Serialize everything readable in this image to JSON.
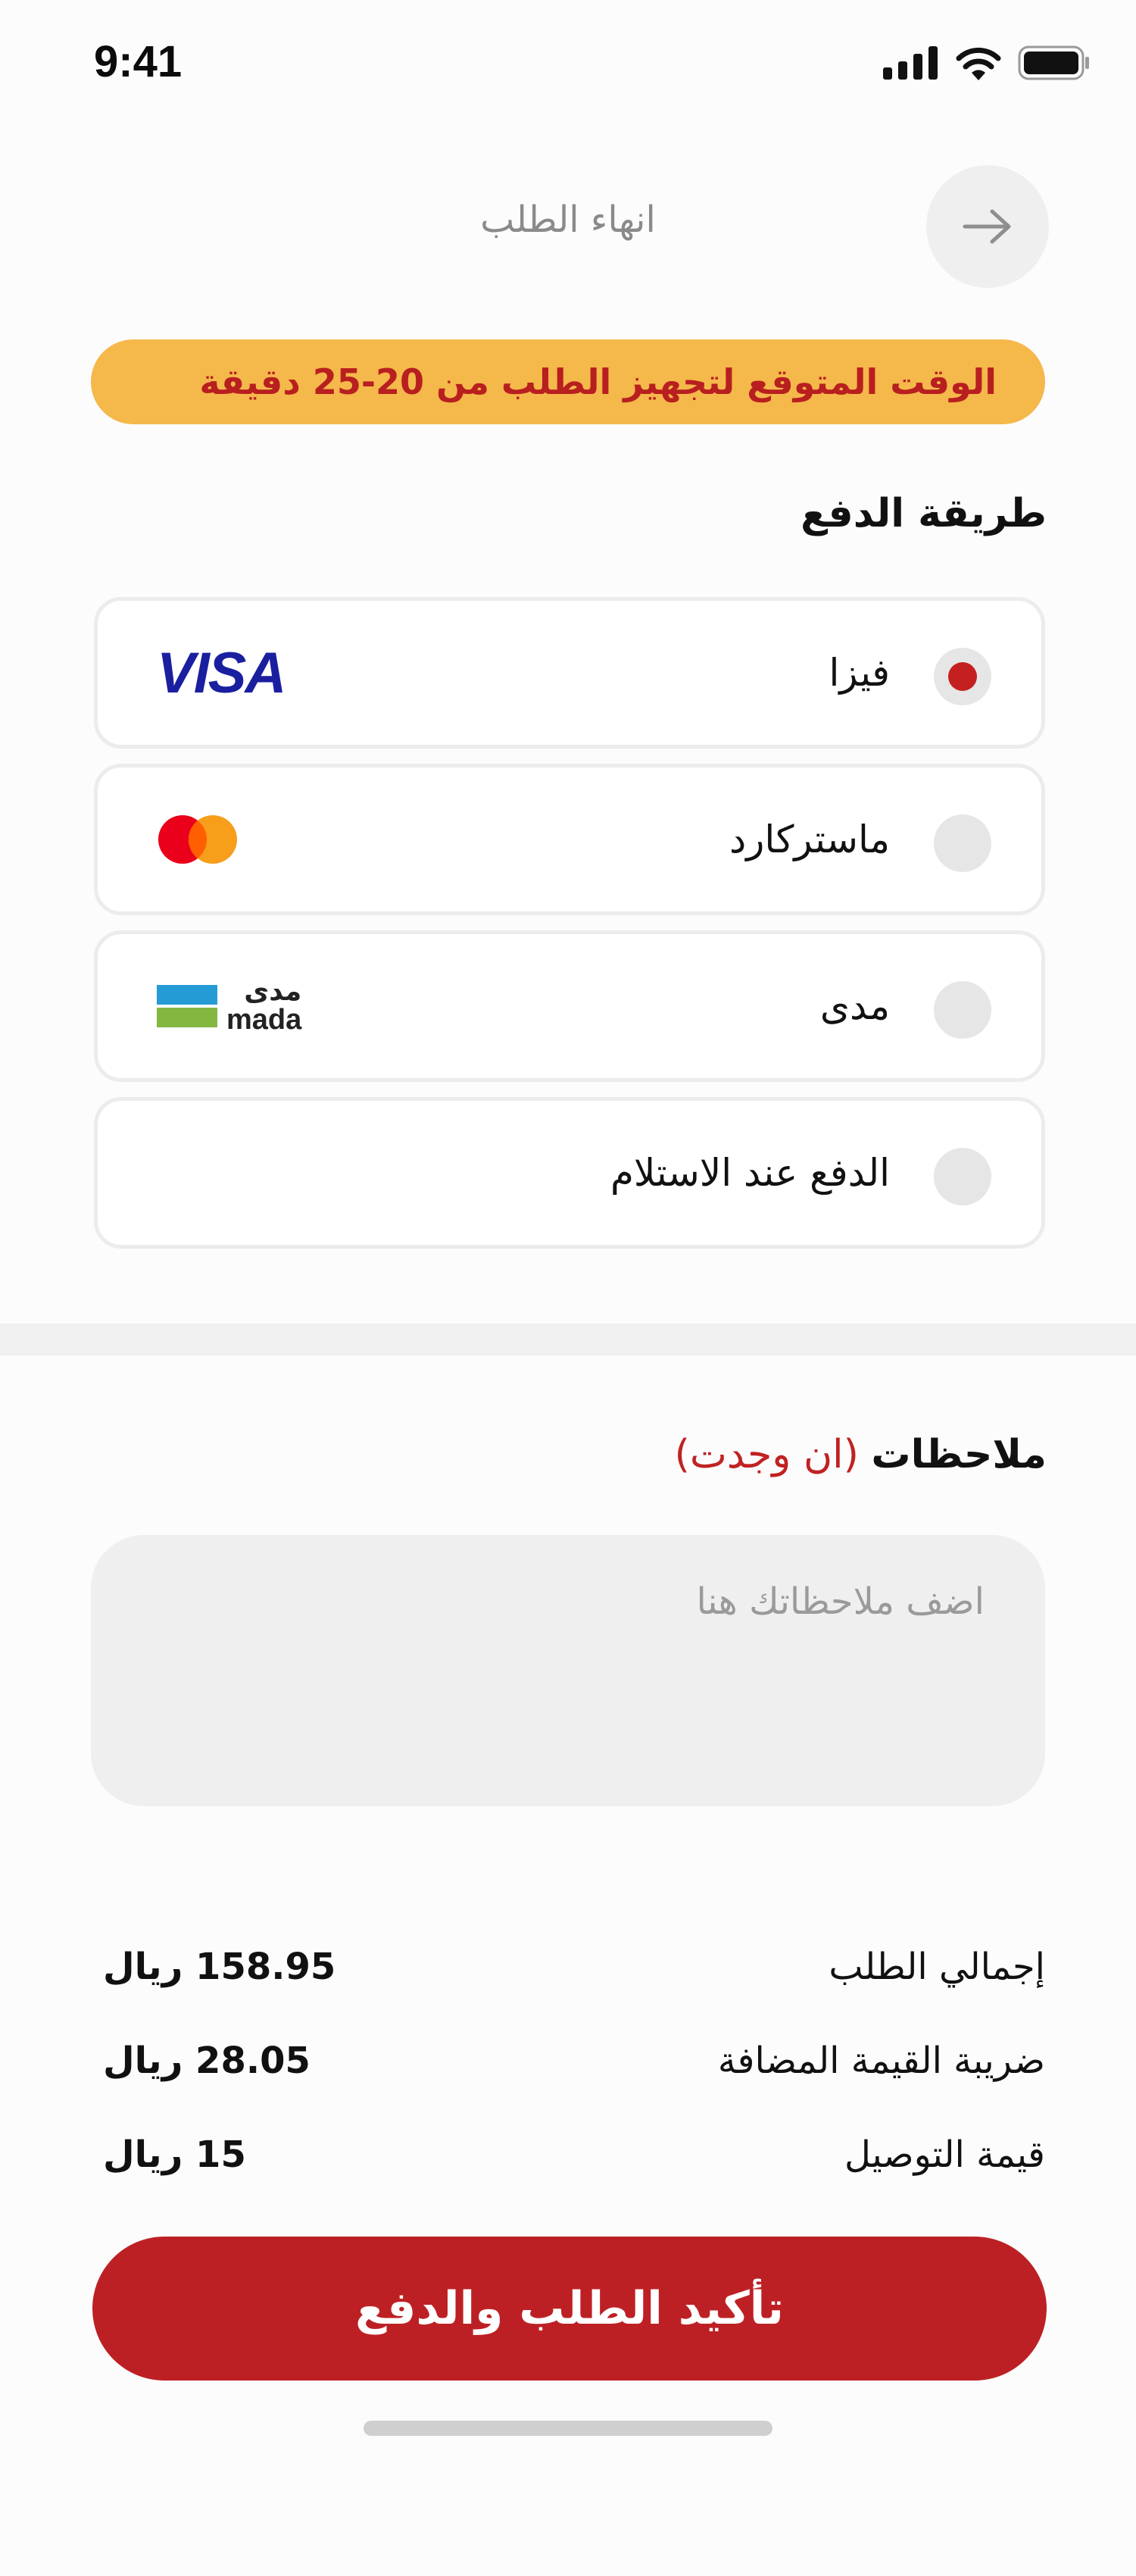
{
  "status_bar": {
    "time": "9:41",
    "icons": [
      "signal-icon",
      "wifi-icon",
      "battery-icon"
    ]
  },
  "header": {
    "title": "انهاء الطلب",
    "back_icon": "arrow-right-icon"
  },
  "estimate_banner": "الوقت المتوقع لتجهيز الطلب من 20-25 دقيقة",
  "payment": {
    "title": "طريقة الدفع",
    "options": [
      {
        "label": "فيزا",
        "logo": "visa-logo",
        "logo_text": "VISA",
        "selected": true
      },
      {
        "label": "ماستركارد",
        "logo": "mastercard-logo",
        "selected": false
      },
      {
        "label": "مدى",
        "logo": "mada-logo",
        "logo_text_ar": "مدى",
        "logo_text_en": "mada",
        "selected": false
      },
      {
        "label": "الدفع عند الاستلام",
        "logo": null,
        "selected": false
      }
    ]
  },
  "notes": {
    "title": "ملاحظات",
    "optional": "(ان وجدت)",
    "placeholder": "اضف ملاحظاتك هنا",
    "value": ""
  },
  "summary": [
    {
      "label": "إجمالي الطلب",
      "value": "158.95 ريال"
    },
    {
      "label": "ضريبة القيمة المضافة",
      "value": "28.05 ريال"
    },
    {
      "label": "قيمة التوصيل",
      "value": "15 ريال"
    }
  ],
  "confirm_button": "تأكيد الطلب والدفع",
  "colors": {
    "primary": "#bd2024",
    "banner": "#f5b84b",
    "visa_blue": "#1a1fa0",
    "mastercard_red": "#eb001b",
    "mastercard_orange": "#f79e1b",
    "mada_blue": "#259bd6",
    "mada_green": "#84b740"
  }
}
